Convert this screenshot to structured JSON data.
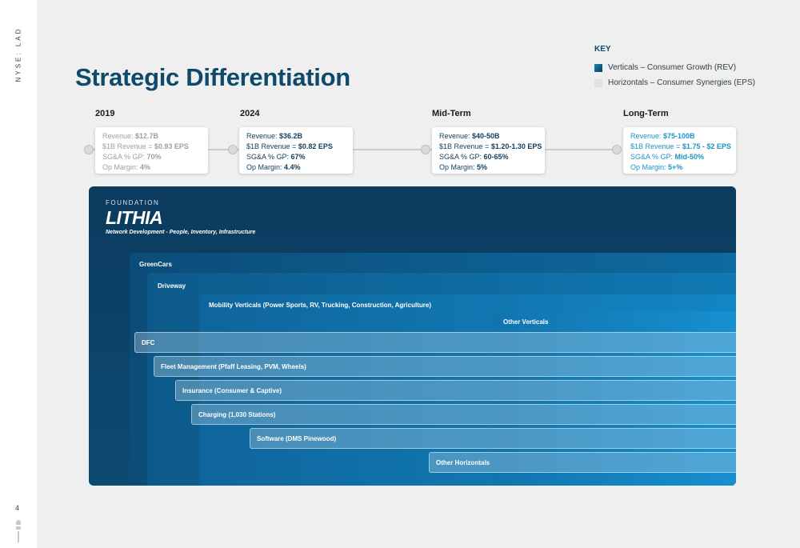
{
  "sidebar": {
    "ticker": "NYSE: LAD",
    "page_number": "4"
  },
  "title": "Strategic Differentiation",
  "key": {
    "title": "KEY",
    "items": [
      {
        "label": "Verticals  – Consumer Growth (REV)",
        "color": "#0e5a85"
      },
      {
        "label": "Horizontals – Consumer Synergies (EPS)",
        "color": "#dfe3e6"
      }
    ]
  },
  "timeline": [
    {
      "period": "2019",
      "revenue_label": "Revenue: ",
      "revenue": "$12.7B",
      "eps_label": "$1B Revenue = ",
      "eps": "$0.93 EPS",
      "sga_label": "SG&A % GP: ",
      "sga": "70%",
      "margin_label": "Op Margin: ",
      "margin": "4%"
    },
    {
      "period": "2024",
      "revenue_label": "Revenue: ",
      "revenue": "$36.2B",
      "eps_label": "$1B Revenue = ",
      "eps": "$0.82 EPS",
      "sga_label": "SG&A % GP: ",
      "sga": "67%",
      "margin_label": "Op Margin: ",
      "margin": "4.4%"
    },
    {
      "period": "Mid-Term",
      "revenue_label": "Revenue: ",
      "revenue": "$40-50B",
      "eps_label": "$1B Revenue = ",
      "eps": "$1.20-1.30 EPS",
      "sga_label": "SG&A % GP: ",
      "sga": "60-65%",
      "margin_label": "Op Margin: ",
      "margin": "5%"
    },
    {
      "period": "Long-Term",
      "revenue_label": "Revenue: ",
      "revenue": "$75-100B",
      "eps_label": "$1B Revenue = ",
      "eps": "$1.75 - $2 EPS",
      "sga_label": "SG&A % GP: ",
      "sga": "Mid-50%",
      "margin_label": "Op Margin: ",
      "margin": "5+%"
    }
  ],
  "foundation": {
    "label": "FOUNDATION",
    "logo_text": "LITHIA",
    "tagline": "Network Development - People, Inventory, Infrastructure"
  },
  "verticals": [
    "GreenCars",
    "Driveway",
    "Mobility Verticals (Power Sports, RV, Trucking, Construction, Agriculture)",
    "Other Verticals"
  ],
  "horizontals": [
    "DFC",
    "Fleet Management (Pfaff Leasing, PVM, Wheels)",
    "Insurance (Consumer & Captive)",
    "Charging (1,030 Stations)",
    "Software (DMS Pinewood)",
    "Other Horizontals"
  ]
}
